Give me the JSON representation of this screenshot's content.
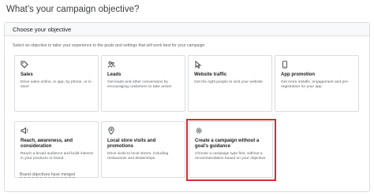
{
  "page": {
    "title": "What's your campaign objective?"
  },
  "panel": {
    "header": "Choose your objective",
    "instructions": "Select an objective to tailor your experience to the goals and settings that will work best for your campaign"
  },
  "objectives": [
    {
      "title": "Sales",
      "description": "Drive sales online, in app, by phone, or in store",
      "icon": "tag-icon"
    },
    {
      "title": "Leads",
      "description": "Get leads and other conversions by encouraging customers to take action",
      "icon": "people-icon"
    },
    {
      "title": "Website traffic",
      "description": "Get the right people to visit your website",
      "icon": "cursor-icon"
    },
    {
      "title": "App promotion",
      "description": "Get more installs, engagement and pre-registration for your app",
      "icon": "phone-icon"
    },
    {
      "title": "Reach, awareness, and consideration",
      "description": "Reach a broad audience and build interest in your products or brand",
      "icon": "megaphone-icon"
    },
    {
      "title": "Local store visits and promotions",
      "description": "Drive visits to local stores, including restaurants and dealerships.",
      "icon": "location-pin-icon"
    },
    {
      "title": "Create a campaign without a goal's guidance",
      "description": "Choose a campaign type first, without a recommendation based on your objective",
      "icon": "gear-icon"
    }
  ],
  "footer": {
    "link": "Brand objectives have merged"
  },
  "colors": {
    "highlight": "#d32f2f",
    "border": "#dadce0",
    "text_secondary": "#5f6368"
  }
}
